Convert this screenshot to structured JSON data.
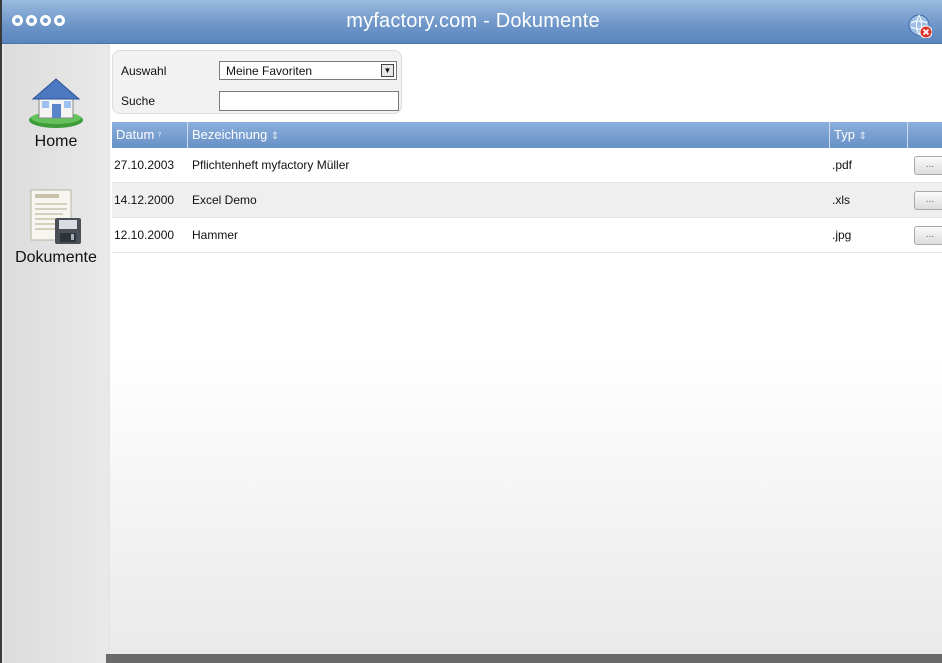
{
  "window": {
    "title": "myfactory.com - Dokumente"
  },
  "sidebar": {
    "items": [
      {
        "label": "Home",
        "icon": "house-icon"
      },
      {
        "label": "Dokumente",
        "icon": "documents-save-icon"
      }
    ]
  },
  "filter": {
    "auswahl_label": "Auswahl",
    "auswahl_value": "Meine Favoriten",
    "suche_label": "Suche",
    "suche_value": ""
  },
  "table": {
    "columns": [
      "Datum",
      "Bezeichnung",
      "Typ"
    ],
    "rows": [
      {
        "datum": "27.10.2003",
        "bezeichnung": "Pflichtenheft myfactory Müller",
        "typ": ".pdf",
        "button": "..."
      },
      {
        "datum": "14.12.2000",
        "bezeichnung": "Excel Demo",
        "typ": ".xls",
        "button": "..."
      },
      {
        "datum": "12.10.2000",
        "bezeichnung": "Hammer",
        "typ": ".jpg",
        "button": "..."
      }
    ]
  },
  "colors": {
    "titlebar": "#6f97c9",
    "table_header": "#6790c6"
  }
}
